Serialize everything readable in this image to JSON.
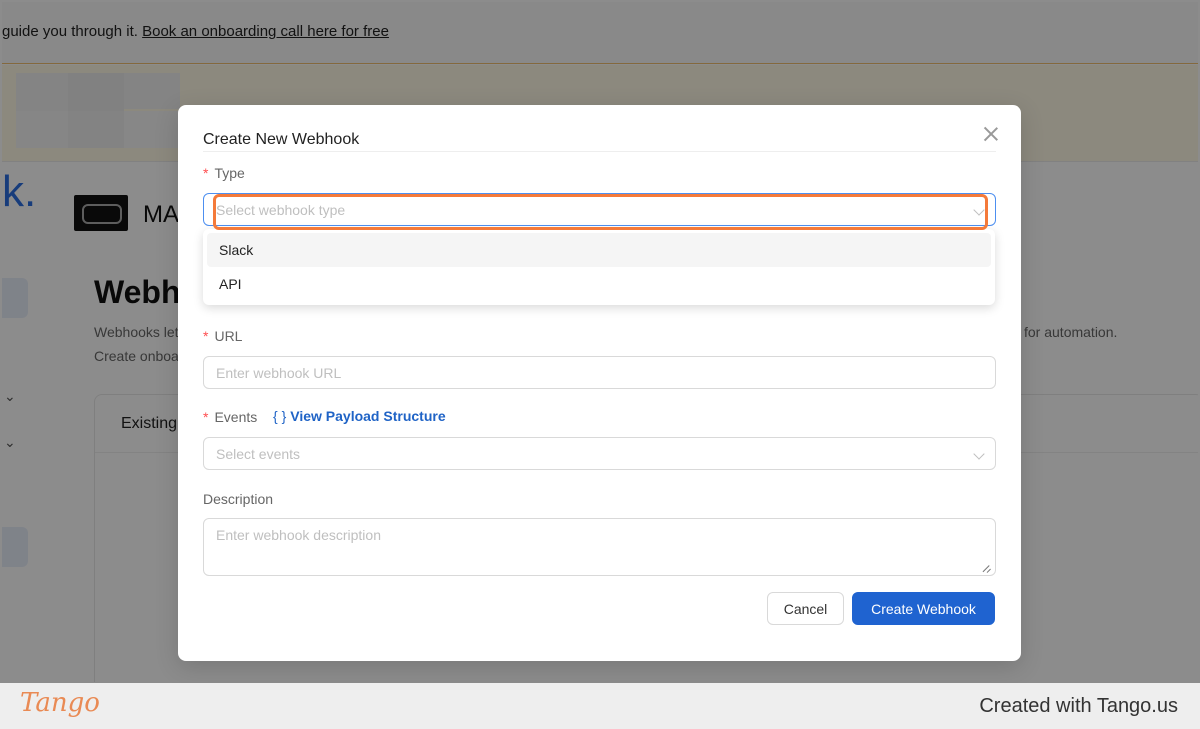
{
  "background": {
    "banner": {
      "text": "guide you through it. ",
      "link": "Book an onboarding call here for free"
    },
    "brand_glyph": "k.",
    "org_name": "MA",
    "page_title": "Webho",
    "page_desc_line1": "Webhooks let",
    "page_desc_line2": "Create onboa",
    "page_desc_right": "for automation.",
    "card_title": "Existing"
  },
  "modal": {
    "title": "Create New Webhook",
    "type": {
      "label": "Type",
      "required_mark": "*",
      "placeholder": "Select webhook type",
      "options": [
        "Slack",
        "API"
      ],
      "highlighted_option": "Slack"
    },
    "url": {
      "label": "URL",
      "required_mark": "*",
      "placeholder": "Enter webhook URL"
    },
    "events": {
      "label": "Events",
      "required_mark": "*",
      "payload_braces": "{ }",
      "payload_link": "View Payload Structure",
      "placeholder": "Select events"
    },
    "description": {
      "label": "Description",
      "placeholder": "Enter webhook description"
    },
    "buttons": {
      "cancel": "Cancel",
      "create": "Create Webhook"
    }
  },
  "footer": {
    "logo": "Tango",
    "credit": "Created with Tango.us"
  },
  "colors": {
    "primary": "#1f63d0",
    "required": "#ff4d4f",
    "highlight": "#f47a3a",
    "tango_orange": "#e98a54"
  }
}
